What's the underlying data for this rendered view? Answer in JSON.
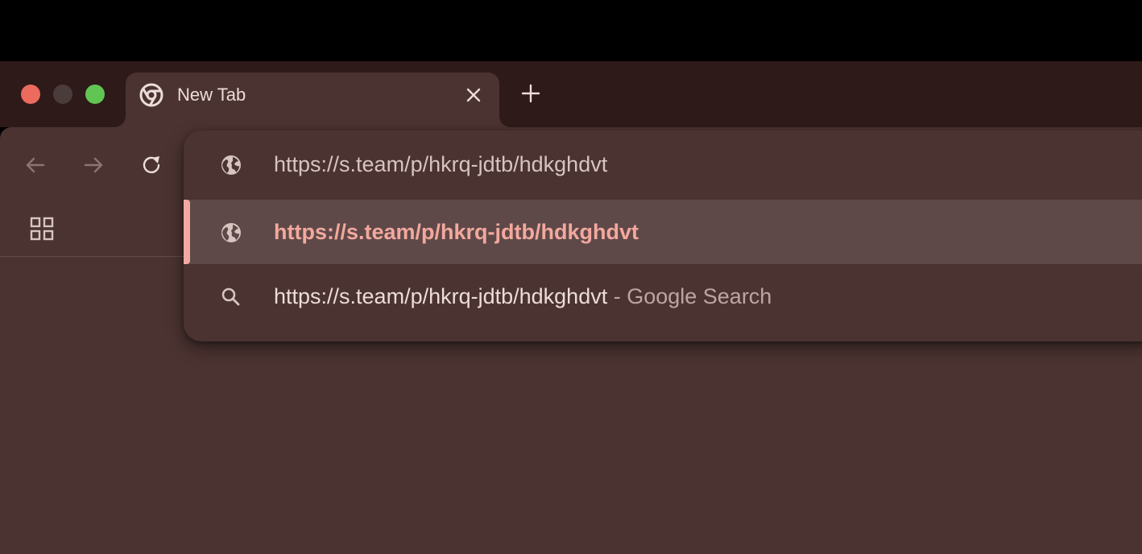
{
  "window": {
    "controls": [
      "close",
      "minimize",
      "maximize"
    ]
  },
  "tab": {
    "title": "New Tab",
    "favicon": "chrome-logo-icon",
    "close_icon": "close-icon"
  },
  "new_tab_icon": "plus-icon",
  "toolbar": {
    "back_icon": "arrow-left-icon",
    "forward_icon": "arrow-right-icon",
    "reload_icon": "reload-icon",
    "apps_icon": "apps-grid-icon"
  },
  "omnibox": {
    "input_value": "https://s.team/p/hkrq-jdtb/hdkghdvt",
    "input_icon": "globe-icon",
    "suggestions": [
      {
        "icon": "globe-icon",
        "text": "https://s.team/p/hkrq-jdtb/hdkghdvt",
        "selected": true
      },
      {
        "icon": "search-icon",
        "text": "https://s.team/p/hkrq-jdtb/hdkghdvt",
        "suffix": " - Google Search",
        "selected": false
      }
    ]
  },
  "colors": {
    "tabstrip_bg": "#2e1a19",
    "toolbar_bg": "#4b3331",
    "selected_row_bg": "#5e4948",
    "accent": "#f3a89e",
    "text_primary": "#ecdcda"
  }
}
